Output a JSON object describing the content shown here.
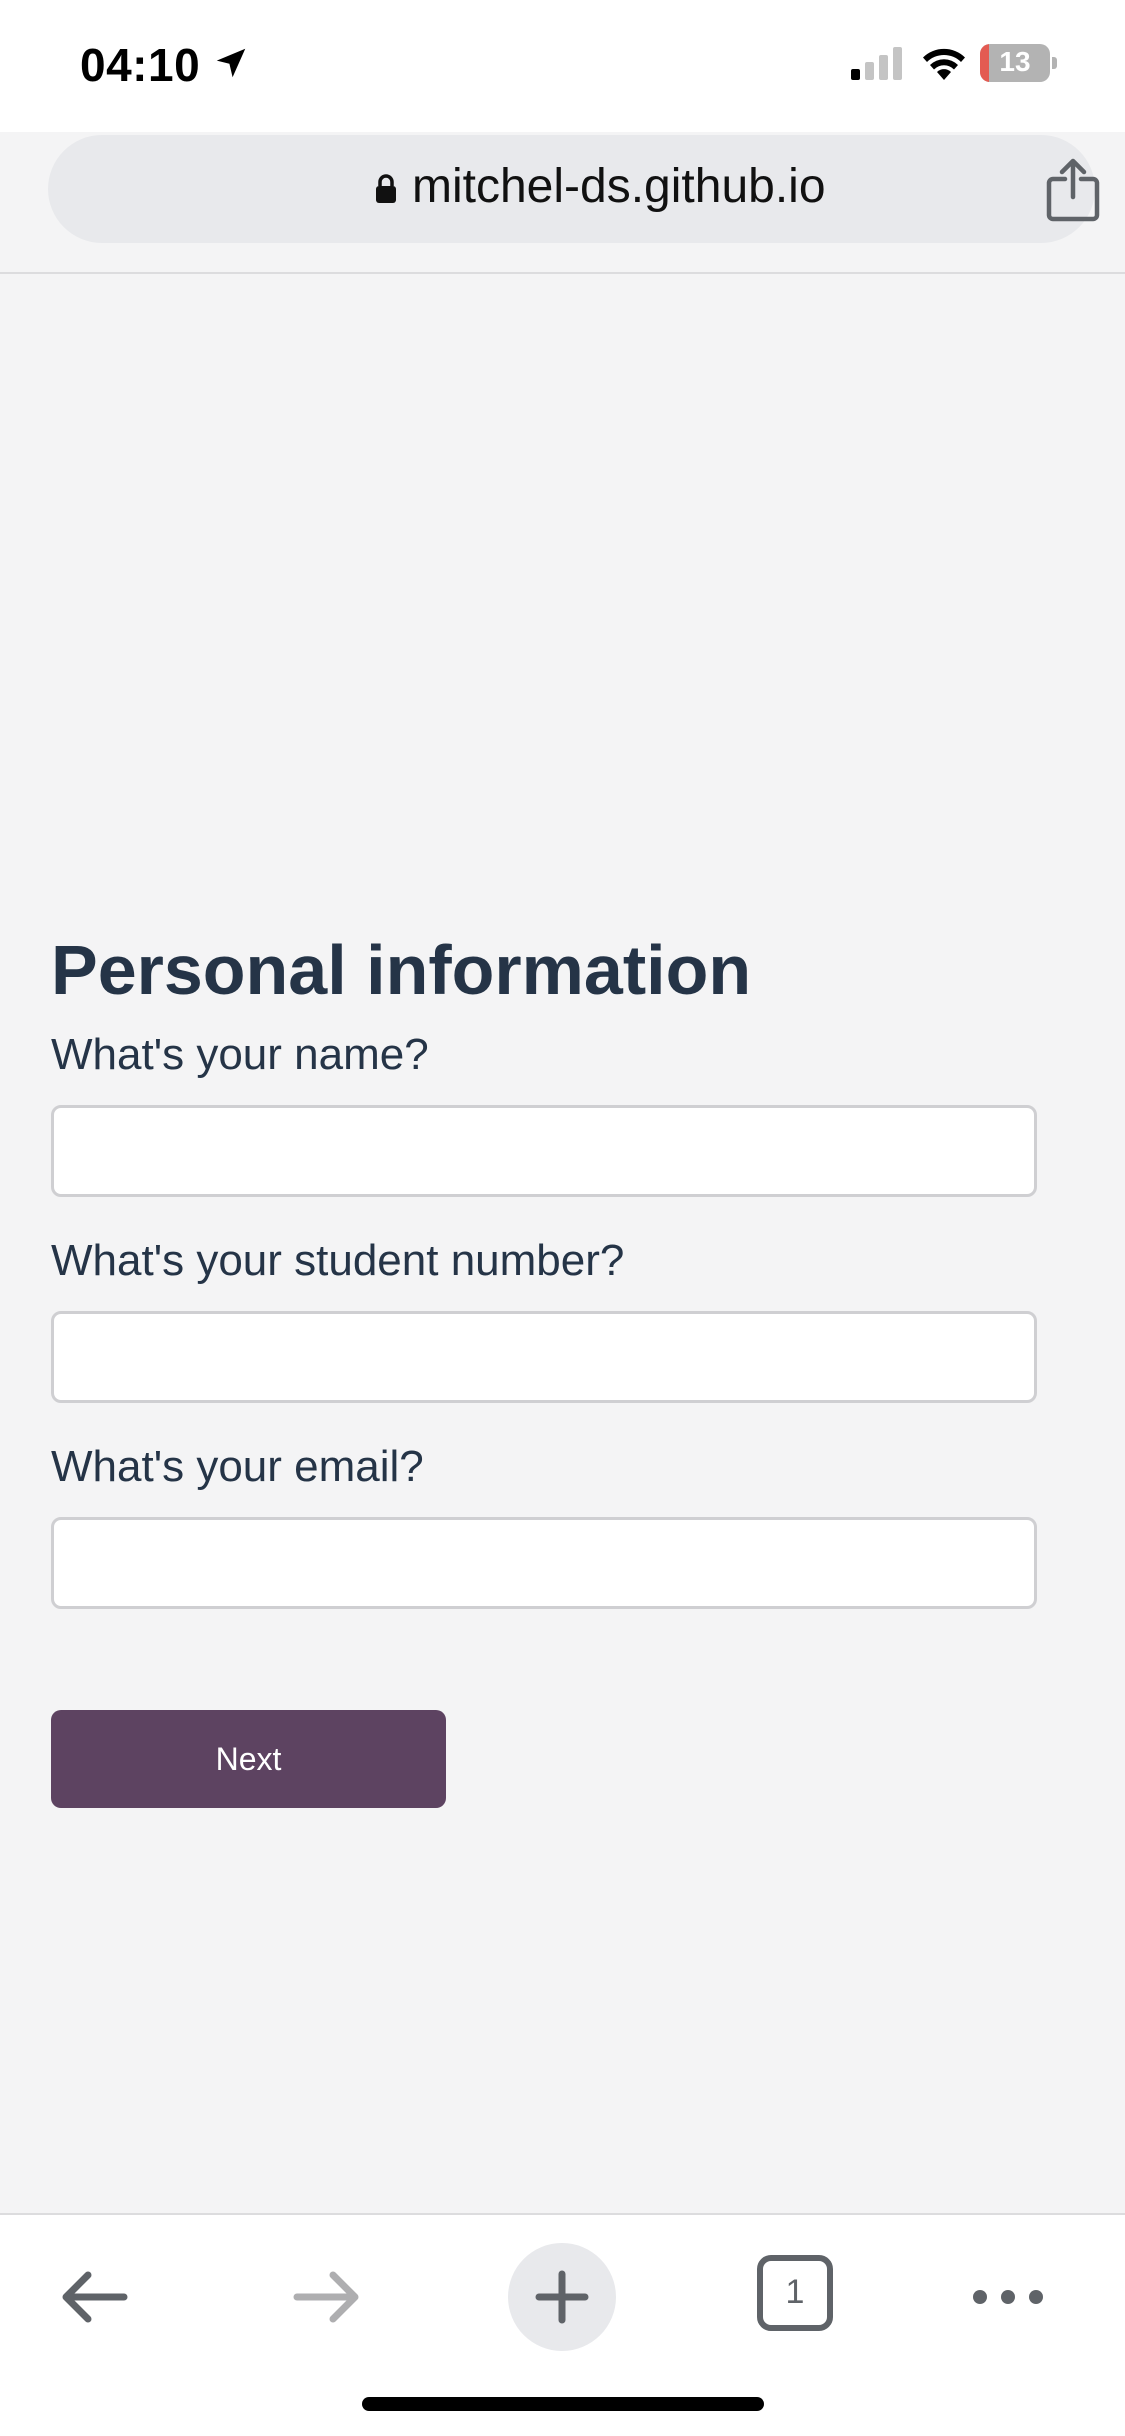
{
  "status_bar": {
    "time": "04:10",
    "battery_level": "13",
    "battery_fraction": 0.13,
    "icons": [
      "location-arrow-icon",
      "cellular-signal-icon",
      "wifi-icon",
      "battery-icon"
    ]
  },
  "browser": {
    "url": "mitchel-ds.github.io",
    "icons": [
      "lock-icon",
      "share-icon"
    ],
    "toolbar": {
      "icons": [
        "back-arrow-icon",
        "forward-arrow-icon",
        "plus-icon",
        "tabs-icon",
        "more-icon"
      ],
      "tab_count": "1"
    }
  },
  "form": {
    "title": "Personal information",
    "fields": [
      {
        "label": "What's your name?",
        "value": ""
      },
      {
        "label": "What's your student number?",
        "value": ""
      },
      {
        "label": "What's your email?",
        "value": ""
      }
    ],
    "next_label": "Next"
  },
  "colors": {
    "page_background": "#f4f4f5",
    "text": "#253447",
    "button": "#5d4361",
    "battery_low": "#e35b52"
  }
}
